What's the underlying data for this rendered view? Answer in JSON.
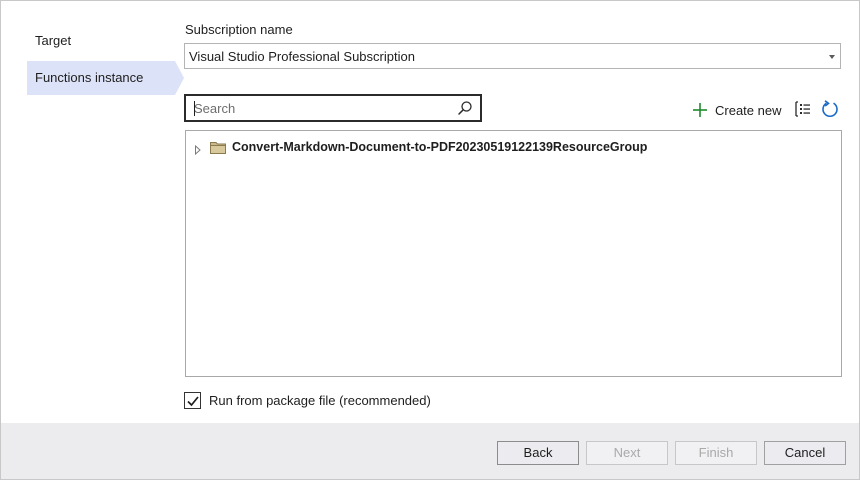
{
  "nav": {
    "items": [
      {
        "label": "Target"
      },
      {
        "label": "Functions instance"
      }
    ]
  },
  "subscription": {
    "label": "Subscription name",
    "value": "Visual Studio Professional Subscription"
  },
  "search": {
    "placeholder": "Search",
    "value": ""
  },
  "toolbar": {
    "create_new_label": "Create new",
    "group_icon": "grouping-icon",
    "refresh_icon": "refresh-icon"
  },
  "tree": {
    "items": [
      {
        "label": "Convert-Markdown-Document-to-PDF20230519122139ResourceGroup",
        "icon": "folder-icon",
        "expanded": false
      }
    ]
  },
  "options": {
    "run_from_package_label": "Run from package file (recommended)",
    "run_from_package_checked": true
  },
  "footer": {
    "back_label": "Back",
    "next_label": "Next",
    "finish_label": "Finish",
    "cancel_label": "Cancel"
  },
  "colors": {
    "selected_nav_bg": "#dce2f7",
    "plus_green": "#1e8a2e",
    "refresh_blue": "#1b6ac9",
    "folder_fill": "#c9b98c"
  }
}
